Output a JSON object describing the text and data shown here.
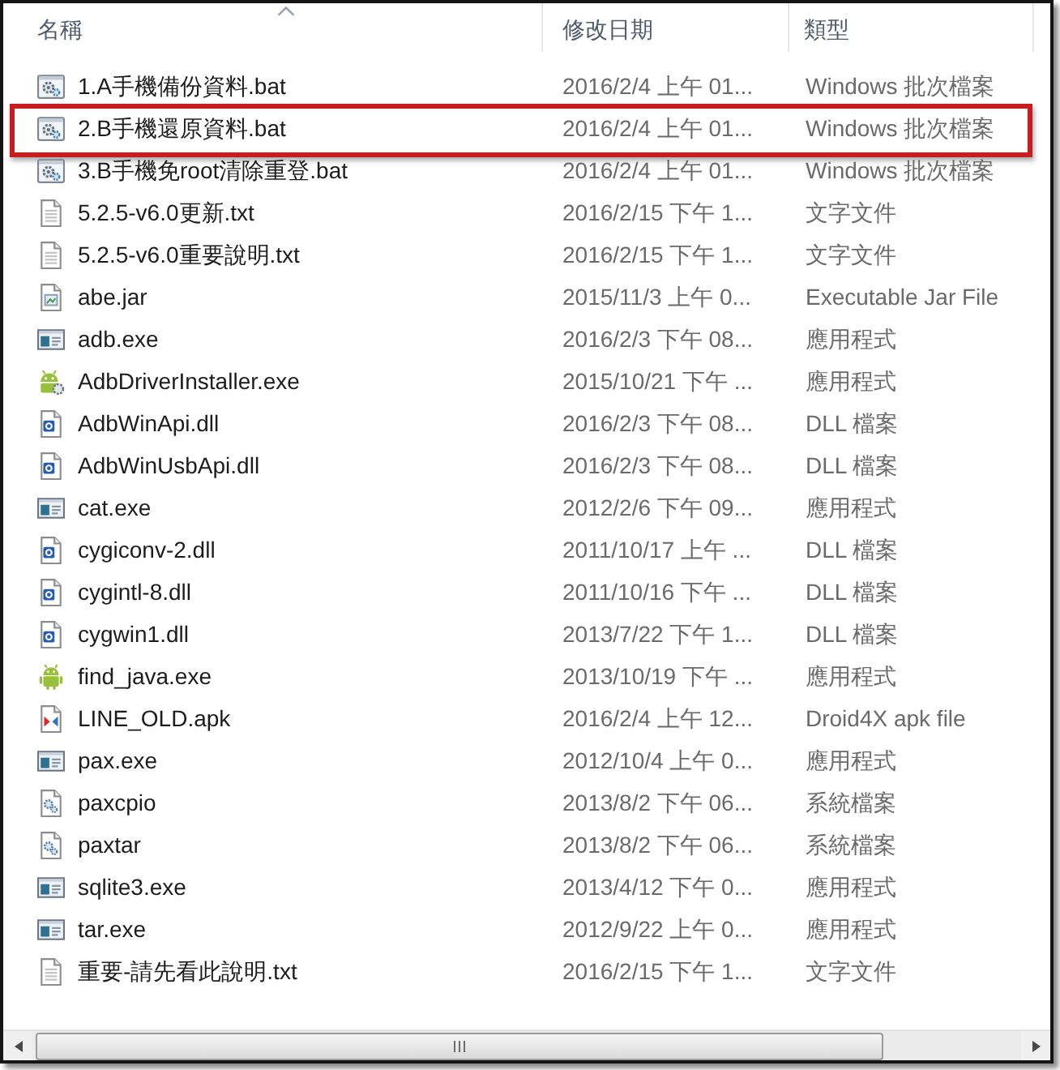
{
  "columns": [
    {
      "label": "名稱",
      "sorted": true
    },
    {
      "label": "修改日期",
      "sorted": false
    },
    {
      "label": "類型",
      "sorted": false
    }
  ],
  "rows": [
    {
      "kind": "batch",
      "name": "1.A手機備份資料.bat",
      "modified": "2016/2/4 上午 01...",
      "type": "Windows 批次檔案",
      "highlighted": false
    },
    {
      "kind": "batch",
      "name": "2.B手機還原資料.bat",
      "modified": "2016/2/4 上午 01...",
      "type": "Windows 批次檔案",
      "highlighted": true
    },
    {
      "kind": "batch",
      "name": "3.B手機免root清除重登.bat",
      "modified": "2016/2/4 上午 01...",
      "type": "Windows 批次檔案",
      "highlighted": false
    },
    {
      "kind": "text",
      "name": "5.2.5-v6.0更新.txt",
      "modified": "2016/2/15 下午 1...",
      "type": "文字文件",
      "highlighted": false
    },
    {
      "kind": "text",
      "name": "5.2.5-v6.0重要說明.txt",
      "modified": "2016/2/15 下午 1...",
      "type": "文字文件",
      "highlighted": false
    },
    {
      "kind": "jar",
      "name": "abe.jar",
      "modified": "2015/11/3 上午 0...",
      "type": "Executable Jar File",
      "highlighted": false
    },
    {
      "kind": "exe",
      "name": "adb.exe",
      "modified": "2016/2/3 下午 08...",
      "type": "應用程式",
      "highlighted": false
    },
    {
      "kind": "installer",
      "name": "AdbDriverInstaller.exe",
      "modified": "2015/10/21 下午 ...",
      "type": "應用程式",
      "highlighted": false
    },
    {
      "kind": "dll",
      "name": "AdbWinApi.dll",
      "modified": "2016/2/3 下午 08...",
      "type": "DLL 檔案",
      "highlighted": false
    },
    {
      "kind": "dll",
      "name": "AdbWinUsbApi.dll",
      "modified": "2016/2/3 下午 08...",
      "type": "DLL 檔案",
      "highlighted": false
    },
    {
      "kind": "exe",
      "name": "cat.exe",
      "modified": "2012/2/6 下午 09...",
      "type": "應用程式",
      "highlighted": false
    },
    {
      "kind": "dll",
      "name": "cygiconv-2.dll",
      "modified": "2011/10/17 上午 ...",
      "type": "DLL 檔案",
      "highlighted": false
    },
    {
      "kind": "dll",
      "name": "cygintl-8.dll",
      "modified": "2011/10/16 下午 ...",
      "type": "DLL 檔案",
      "highlighted": false
    },
    {
      "kind": "dll",
      "name": "cygwin1.dll",
      "modified": "2013/7/22 下午 1...",
      "type": "DLL 檔案",
      "highlighted": false
    },
    {
      "kind": "robot",
      "name": "find_java.exe",
      "modified": "2013/10/19 下午 ...",
      "type": "應用程式",
      "highlighted": false
    },
    {
      "kind": "apk",
      "name": "LINE_OLD.apk",
      "modified": "2016/2/4 上午 12...",
      "type": "Droid4X apk file",
      "highlighted": false
    },
    {
      "kind": "exe",
      "name": "pax.exe",
      "modified": "2012/10/4 上午 0...",
      "type": "應用程式",
      "highlighted": false
    },
    {
      "kind": "system",
      "name": "paxcpio",
      "modified": "2013/8/2 下午 06...",
      "type": "系統檔案",
      "highlighted": false
    },
    {
      "kind": "system",
      "name": "paxtar",
      "modified": "2013/8/2 下午 06...",
      "type": "系統檔案",
      "highlighted": false
    },
    {
      "kind": "exe",
      "name": "sqlite3.exe",
      "modified": "2013/4/12 下午 0...",
      "type": "應用程式",
      "highlighted": false
    },
    {
      "kind": "exe",
      "name": "tar.exe",
      "modified": "2012/9/22 上午 0...",
      "type": "應用程式",
      "highlighted": false
    },
    {
      "kind": "text",
      "name": "重要-請先看此說明.txt",
      "modified": "2016/2/15 下午 1...",
      "type": "文字文件",
      "highlighted": false
    }
  ]
}
